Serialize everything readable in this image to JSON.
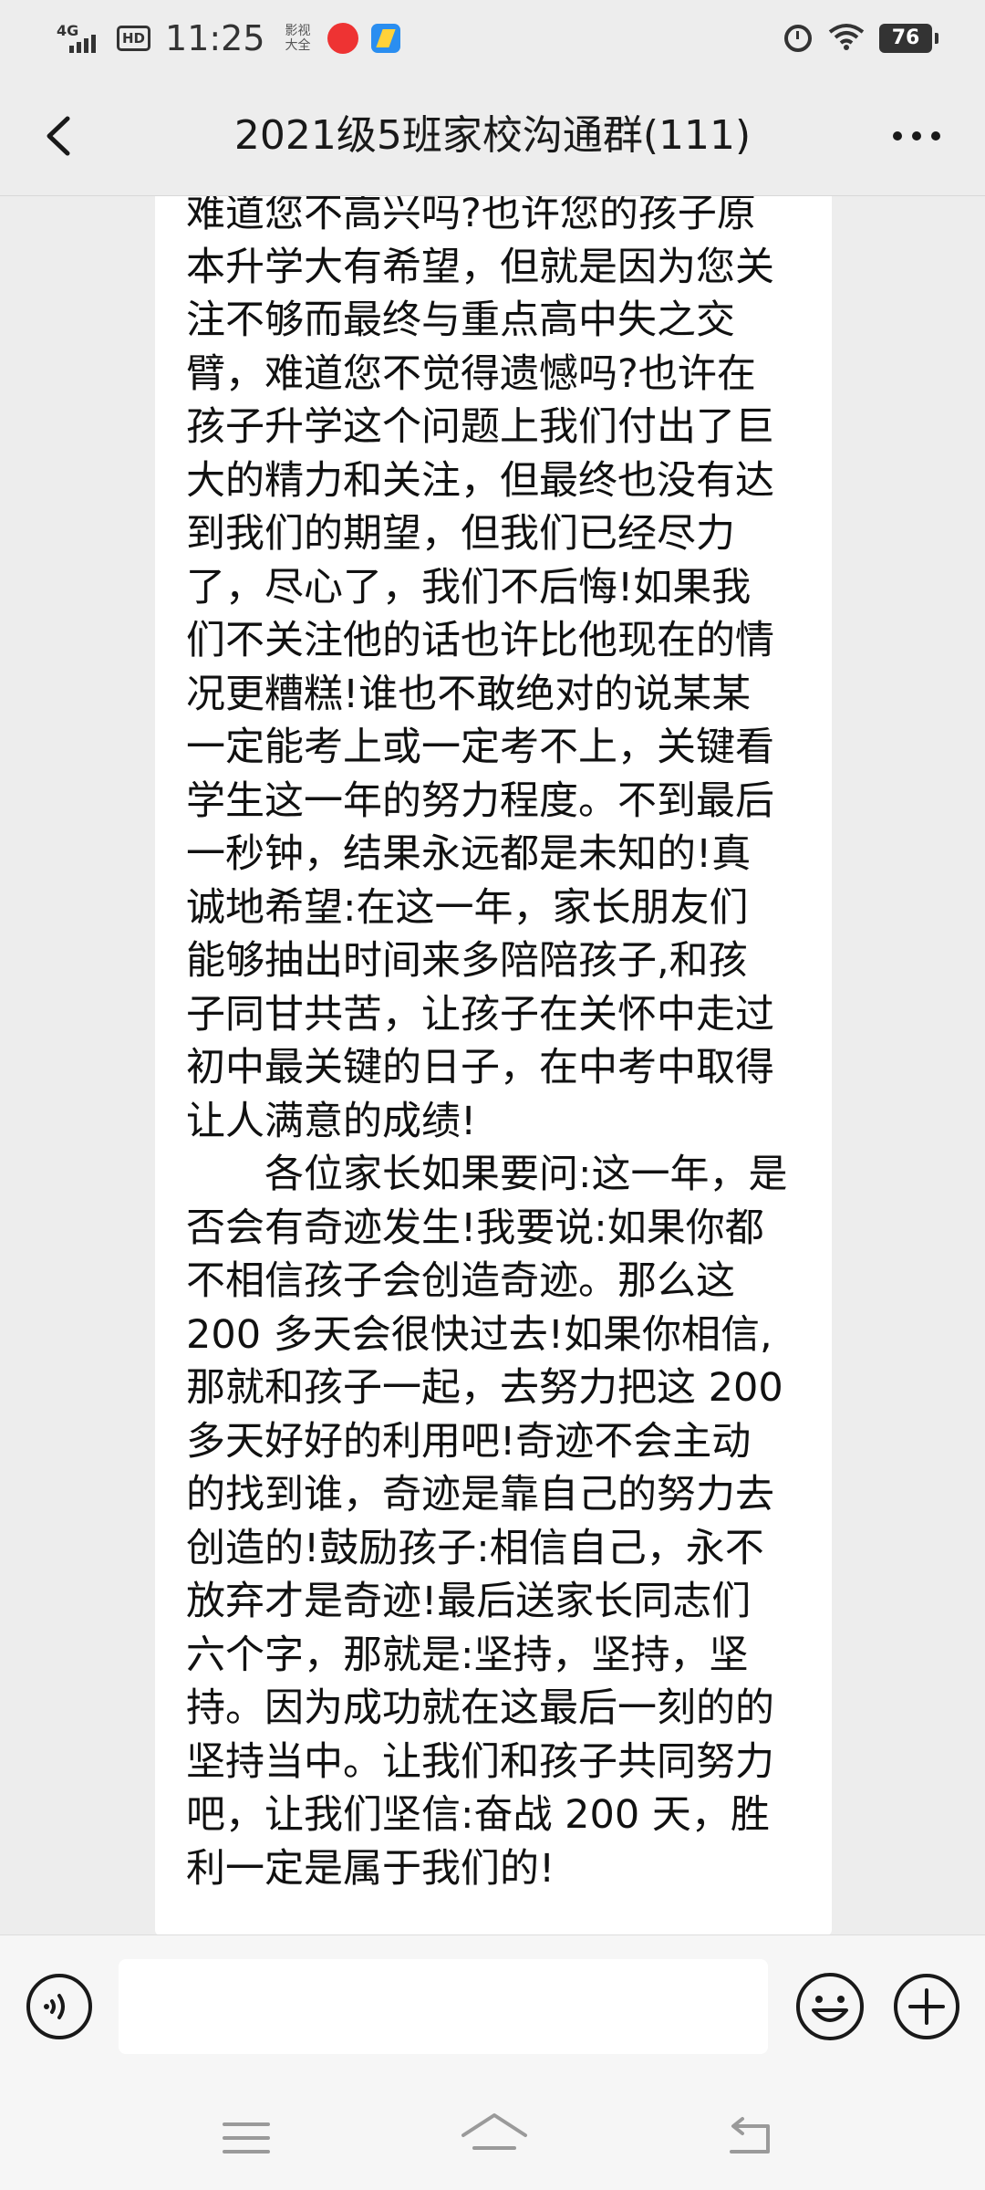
{
  "status_bar": {
    "network": "4G",
    "hd": "HD",
    "time": "11:25",
    "app_badge_1": "影视大全",
    "battery": "76"
  },
  "header": {
    "title": "2021级5班家校沟通群(111)",
    "back_icon": "chevron-left-icon",
    "more_icon": "more-horizontal-icon"
  },
  "message": {
    "lines": [
      "难道您不高兴吗?也许您的孩子原",
      "本升学大有希望，但就是因为您关",
      "注不够而最终与重点高中失之交",
      "臂，难道您不觉得遗憾吗?也许在",
      "孩子升学这个问题上我们付出了巨",
      "大的精力和关注，但最终也没有达",
      "到我们的期望，但我们已经尽力",
      "了，尽心了，我们不后悔!如果我",
      "们不关注他的话也许比他现在的情",
      "况更糟糕!谁也不敢绝对的说某某",
      "一定能考上或一定考不上，关键看",
      "学生这一年的努力程度。不到最后",
      "一秒钟，结果永远都是未知的!真",
      "诚地希望:在这一年，家长朋友们",
      "能够抽出时间来多陪陪孩子,和孩",
      "子同甘共苦，让孩子在关怀中走过",
      "初中最关键的日子，在中考中取得",
      "让人满意的成绩!",
      "    各位家长如果要问:这一年，是",
      "否会有奇迹发生!我要说:如果你都",
      "不相信孩子会创造奇迹。那么这",
      "200 多天会很快过去!如果你相信,",
      "那就和孩子一起，去努力把这 200",
      "多天好好的利用吧!奇迹不会主动",
      "的找到谁，奇迹是靠自己的努力去",
      "创造的!鼓励孩子:相信自己，永不",
      "放弃才是奇迹!最后送家长同志们",
      "六个字，那就是:坚持，坚持，坚",
      "持。因为成功就在这最后一刻的的",
      "坚持当中。让我们和孩子共同努力",
      "吧，让我们坚信:奋战 200 天，胜",
      "利一定是属于我们的!"
    ]
  },
  "input_bar": {
    "voice_icon": "voice-icon",
    "input_value": "",
    "emoji_icon": "emoji-icon",
    "plus_icon": "plus-icon"
  },
  "nav_bar": {
    "menu_icon": "menu-icon",
    "home_icon": "home-icon",
    "back_icon": "back-icon"
  },
  "colors": {
    "background": "#ededed",
    "bubble": "#ffffff",
    "text": "#111111"
  }
}
